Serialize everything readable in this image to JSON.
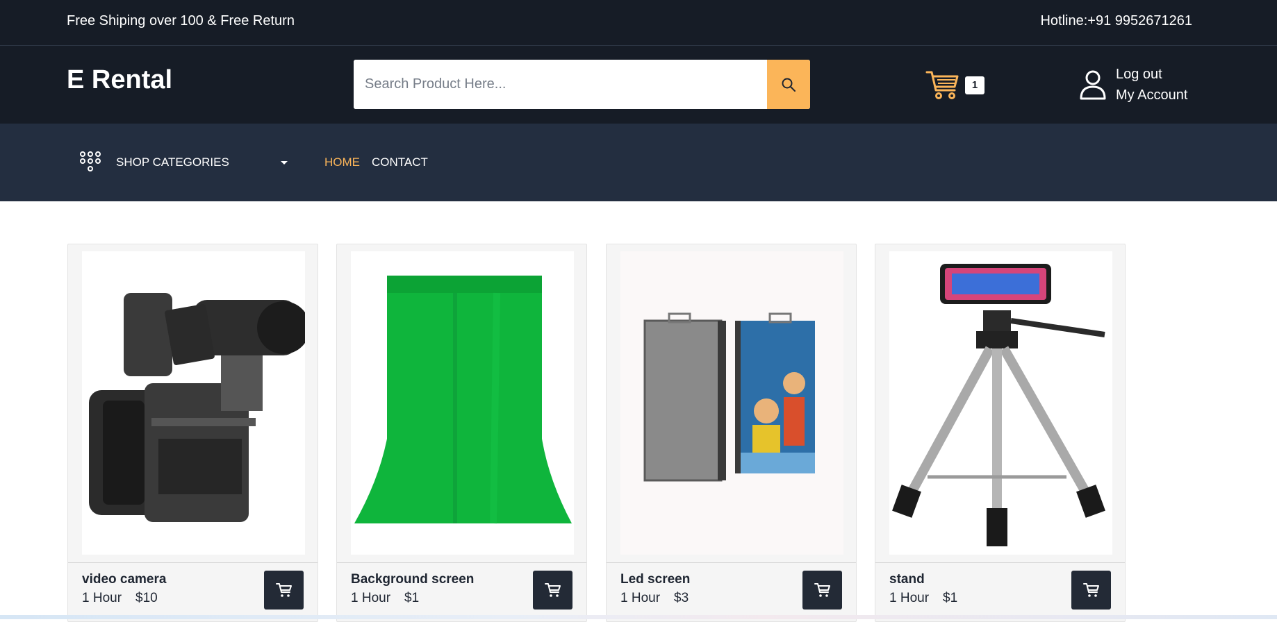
{
  "topbar": {
    "shipping_text": "Free Shiping over 100 & Free Return",
    "hotline_text": "Hotline:+91 9952671261"
  },
  "header": {
    "logo": "E Rental",
    "search_placeholder": "Search Product Here...",
    "cart_count": "1",
    "logout_label": "Log out",
    "account_label": "My Account"
  },
  "nav": {
    "categories_label": "SHOP CATEGORIES",
    "links": [
      {
        "label": "HOME",
        "active": true
      },
      {
        "label": "CONTACT",
        "active": false
      }
    ]
  },
  "products": [
    {
      "name": "video camera",
      "duration": "1 Hour",
      "price": "$10",
      "image": "video-camera-image"
    },
    {
      "name": "Background screen",
      "duration": "1 Hour",
      "price": "$1",
      "image": "green-screen-image"
    },
    {
      "name": "Led screen",
      "duration": "1 Hour",
      "price": "$3",
      "image": "led-panel-image"
    },
    {
      "name": "stand",
      "duration": "1 Hour",
      "price": "$1",
      "image": "tripod-image"
    }
  ],
  "colors": {
    "dark_header": "#161c26",
    "nav_bg": "#232e40",
    "accent": "#fbb559"
  }
}
